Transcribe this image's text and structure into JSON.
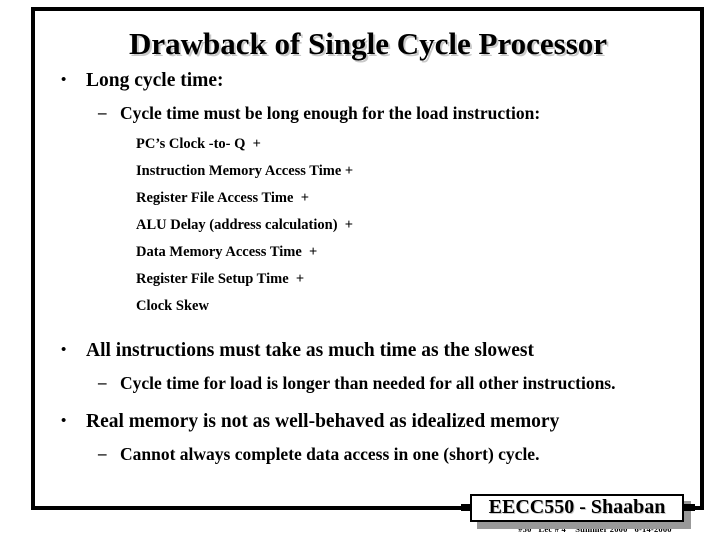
{
  "slide": {
    "title": "Drawback of Single Cycle Processor",
    "background_color": "#ffffff",
    "text_color": "#000000",
    "shadow_color": "#c9c9c9"
  },
  "bullets": {
    "b1": "Long cycle time:",
    "b1_sub1": "Cycle time must be long enough for the load instruction:",
    "b2": "All instructions must take as much time as the slowest",
    "b2_sub1": "Cycle time for load is  longer than needed for all other instructions.",
    "b3": "Real memory is not as well-behaved as idealized memory",
    "b3_sub1": "Cannot always complete data access in one (short) cycle."
  },
  "bullet_glyphs": {
    "level1": "•",
    "level2": "–"
  },
  "timing_terms": [
    "PC’s Clock -to- Q  +",
    "Instruction Memory Access Time +",
    "Register File Access Time  +",
    "ALU Delay (address calculation)  +",
    "Data Memory Access Time  +",
    "Register File Setup Time  +",
    "Clock Skew"
  ],
  "footer": {
    "stamp": "EECC550 - Shaaban",
    "meta": "#50   Lec # 4    Summer 2000   6-14-2000",
    "shadow_color": "#999999"
  }
}
